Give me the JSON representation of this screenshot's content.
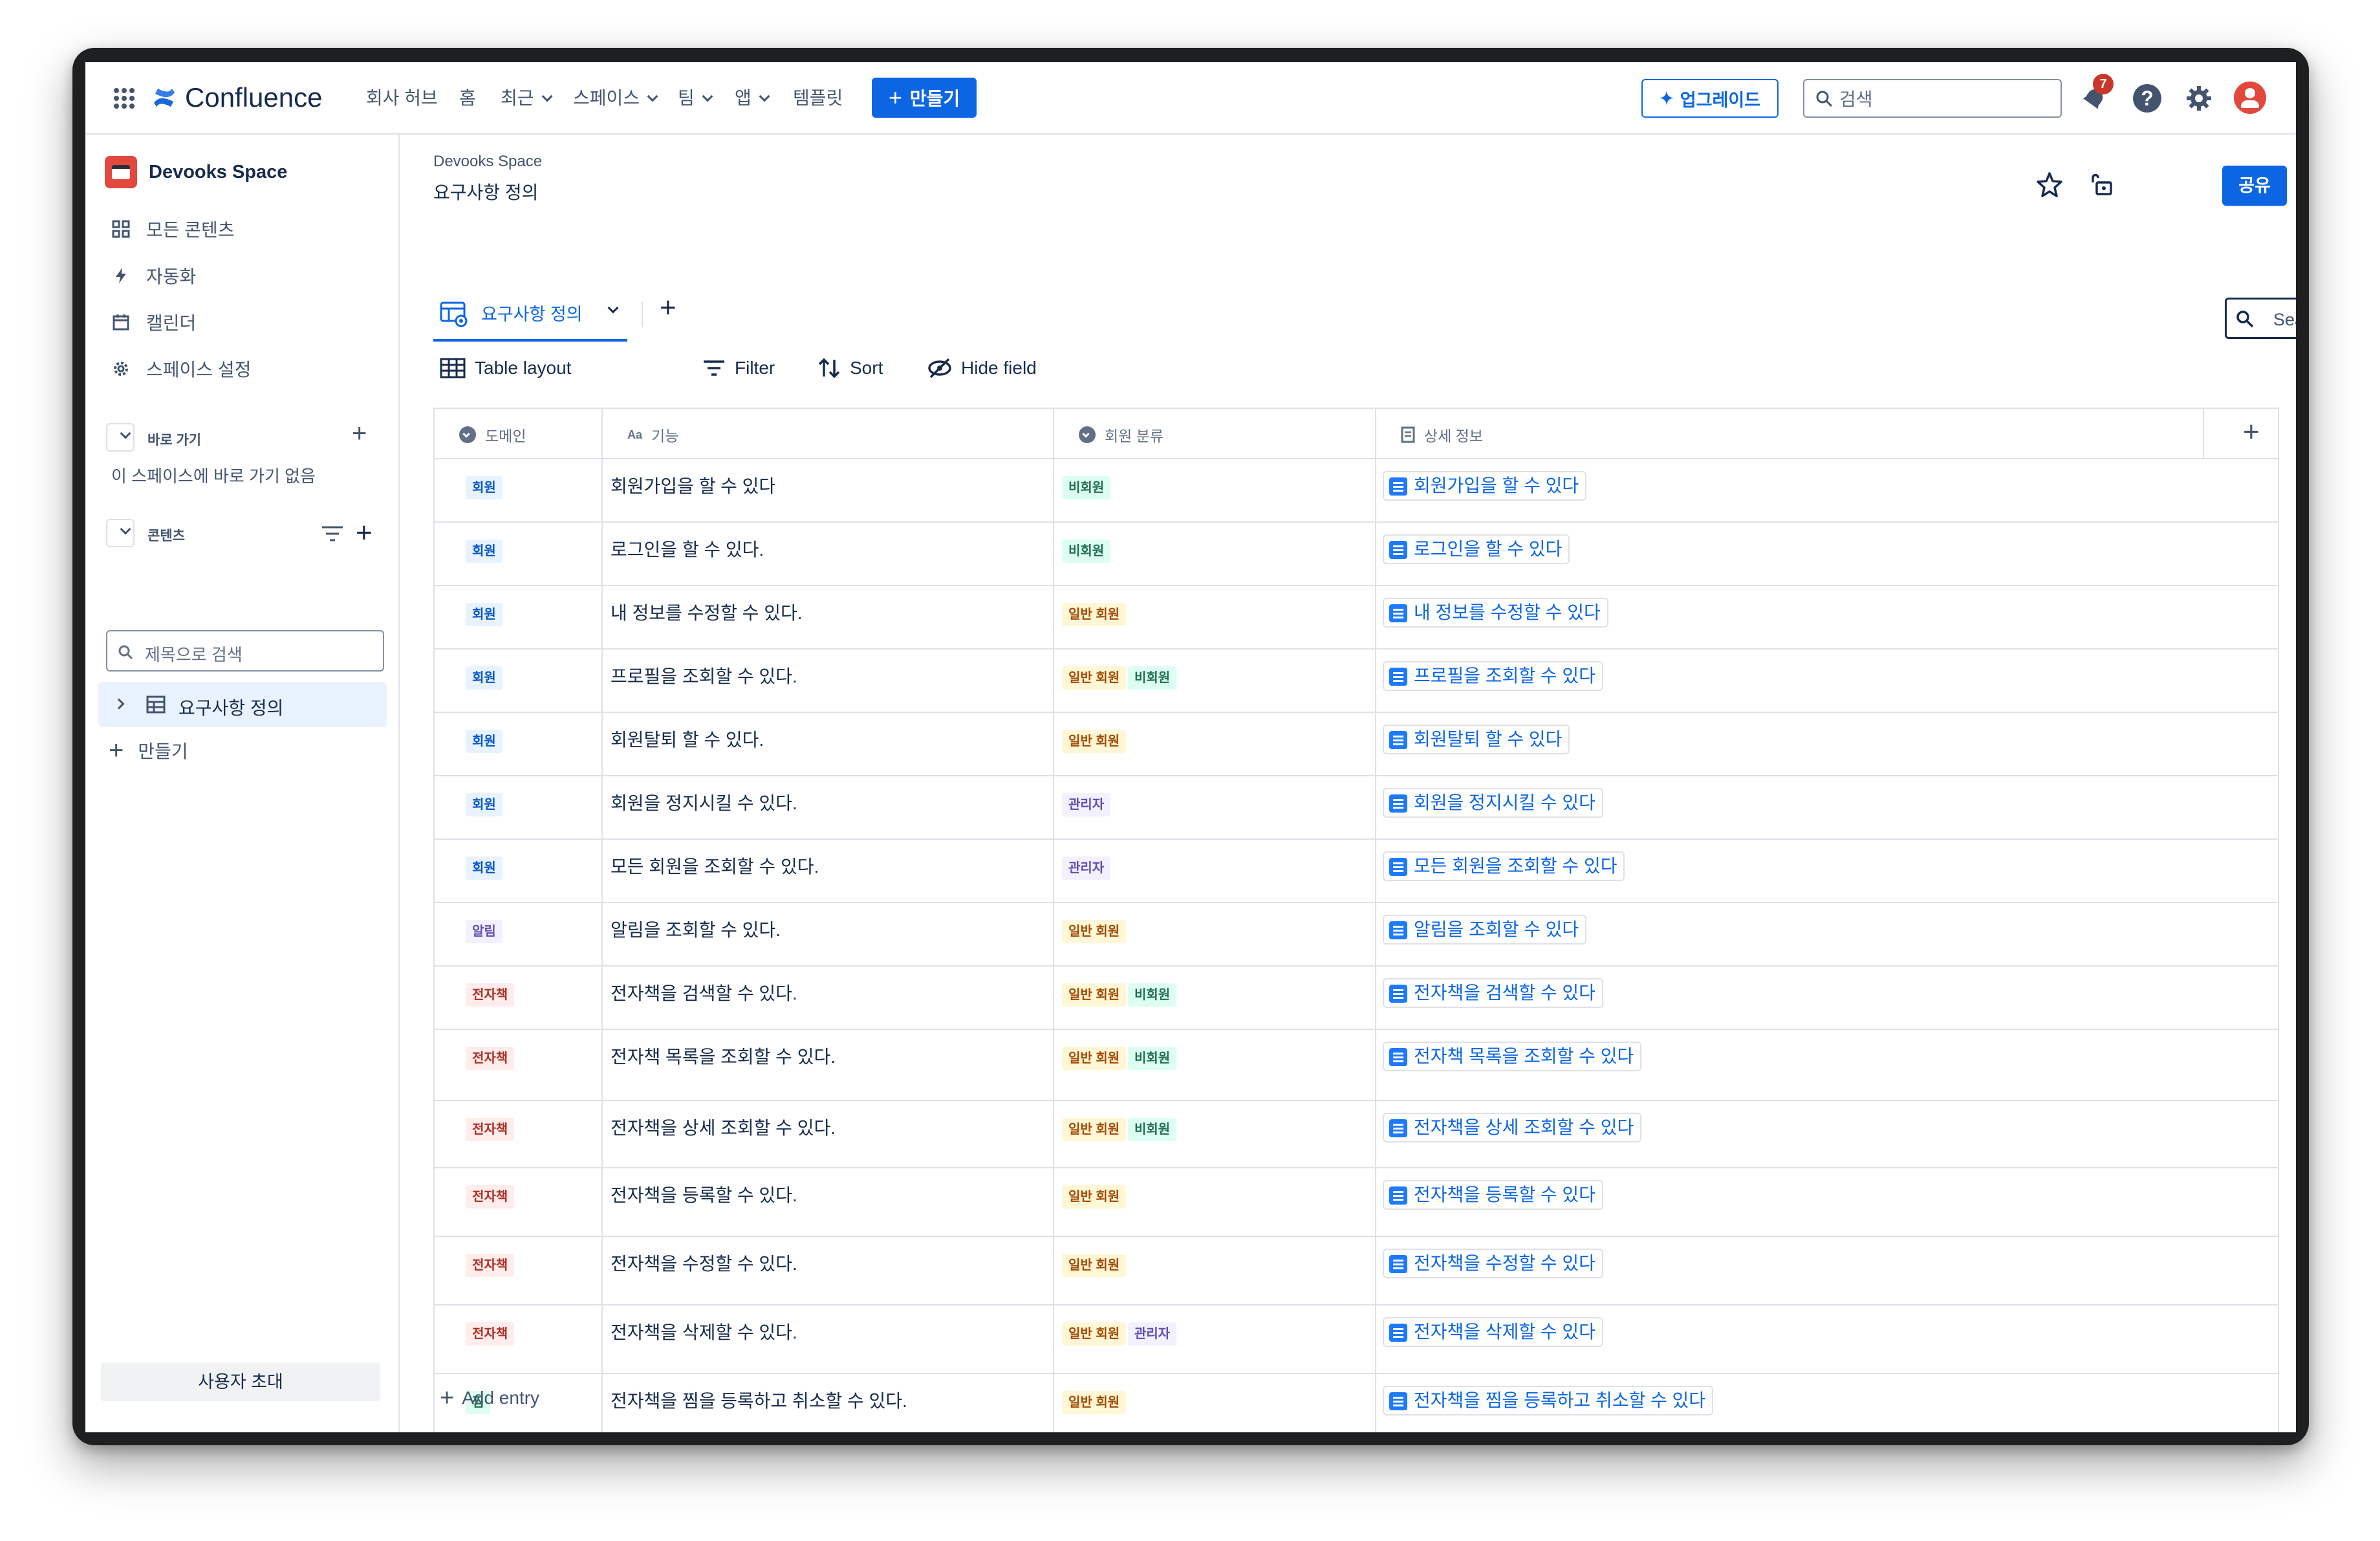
{
  "topnav": {
    "brand": "Confluence",
    "items": [
      "회사 허브",
      "홈",
      "최근",
      "스페이스",
      "팀",
      "앱",
      "템플릿"
    ],
    "create_label": "만들기",
    "upgrade_label": "업그레이드",
    "search_placeholder": "검색",
    "notification_count": "7"
  },
  "sidebar": {
    "space_name": "Devooks Space",
    "items": [
      "모든 콘텐츠",
      "자동화",
      "캘린더",
      "스페이스 설정"
    ],
    "shortcuts_title": "바로 가기",
    "shortcuts_empty": "이 스페이스에 바로 가기 없음",
    "content_title": "콘텐츠",
    "filter_placeholder": "제목으로 검색",
    "tree_item": "요구사항 정의",
    "create_label": "만들기",
    "invite_label": "사용자 초대"
  },
  "page": {
    "breadcrumb": "Devooks Space",
    "title": "요구사항 정의",
    "share_label": "공유",
    "view_tab": "요구사항 정의",
    "search_placeholder": "Search...",
    "toolbar": {
      "layout": "Table layout",
      "filter": "Filter",
      "sort": "Sort",
      "hide": "Hide field"
    },
    "add_entry": "Add entry"
  },
  "table": {
    "columns": [
      "도메인",
      "기능",
      "회원 분류",
      "상세 정보"
    ],
    "rows": [
      {
        "domain": "회원",
        "domain_color": "blue",
        "feature": "회원가입을 할 수 있다",
        "member": [
          [
            "비회원",
            "green"
          ]
        ],
        "detail": "회원가입을 할 수 있다"
      },
      {
        "domain": "회원",
        "domain_color": "blue",
        "feature": "로그인을 할 수 있다.",
        "member": [
          [
            "비회원",
            "green"
          ]
        ],
        "detail": "로그인을 할 수 있다"
      },
      {
        "domain": "회원",
        "domain_color": "blue",
        "feature": "내 정보를 수정할 수 있다.",
        "member": [
          [
            "일반 회원",
            "orange"
          ]
        ],
        "detail": "내 정보를 수정할 수 있다"
      },
      {
        "domain": "회원",
        "domain_color": "blue",
        "feature": "프로필을 조회할 수 있다.",
        "member": [
          [
            "일반 회원",
            "orange"
          ],
          [
            "비회원",
            "green"
          ]
        ],
        "detail": "프로필을 조회할 수 있다"
      },
      {
        "domain": "회원",
        "domain_color": "blue",
        "feature": "회원탈퇴 할 수 있다.",
        "member": [
          [
            "일반 회원",
            "orange"
          ]
        ],
        "detail": "회원탈퇴 할 수 있다"
      },
      {
        "domain": "회원",
        "domain_color": "blue",
        "feature": "회원을 정지시킬 수 있다.",
        "member": [
          [
            "관리자",
            "gpurple"
          ]
        ],
        "detail": "회원을 정지시킬 수 있다"
      },
      {
        "domain": "회원",
        "domain_color": "blue",
        "feature": "모든 회원을 조회할 수 있다.",
        "member": [
          [
            "관리자",
            "gpurple"
          ]
        ],
        "detail": "모든 회원을 조회할 수 있다"
      },
      {
        "domain": "알림",
        "domain_color": "purple",
        "feature": "알림을 조회할 수 있다.",
        "member": [
          [
            "일반 회원",
            "orange"
          ]
        ],
        "detail": "알림을 조회할 수 있다"
      },
      {
        "domain": "전자책",
        "domain_color": "red",
        "feature": "전자책을 검색할 수 있다.",
        "member": [
          [
            "일반 회원",
            "orange"
          ],
          [
            "비회원",
            "green"
          ]
        ],
        "detail": "전자책을 검색할 수 있다"
      },
      {
        "domain": "전자책",
        "domain_color": "red",
        "feature": "전자책 목록을 조회할 수 있다.",
        "member": [
          [
            "일반 회원",
            "orange"
          ],
          [
            "비회원",
            "green"
          ]
        ],
        "detail": "전자책 목록을 조회할 수 있다"
      },
      {
        "domain": "전자책",
        "domain_color": "red",
        "feature": "전자책을 상세 조회할 수 있다.",
        "member": [
          [
            "일반 회원",
            "orange"
          ],
          [
            "비회원",
            "green"
          ]
        ],
        "detail": "전자책을 상세 조회할 수 있다"
      },
      {
        "domain": "전자책",
        "domain_color": "red",
        "feature": "전자책을 등록할 수 있다.",
        "member": [
          [
            "일반 회원",
            "orange"
          ]
        ],
        "detail": "전자책을 등록할 수 있다"
      },
      {
        "domain": "전자책",
        "domain_color": "red",
        "feature": "전자책을 수정할 수 있다.",
        "member": [
          [
            "일반 회원",
            "orange"
          ]
        ],
        "detail": "전자책을 수정할 수 있다"
      },
      {
        "domain": "전자책",
        "domain_color": "red",
        "feature": "전자책을 삭제할 수 있다.",
        "member": [
          [
            "일반 회원",
            "orange"
          ],
          [
            "관리자",
            "gpurple"
          ]
        ],
        "detail": "전자책을 삭제할 수 있다"
      },
      {
        "domain": "찜",
        "domain_color": "green",
        "feature": "전자책을 찜을 등록하고 취소할 수 있다.",
        "member": [
          [
            "일반 회원",
            "orange"
          ]
        ],
        "detail": "전자책을 찜을 등록하고 취소할 수 있다"
      }
    ]
  }
}
